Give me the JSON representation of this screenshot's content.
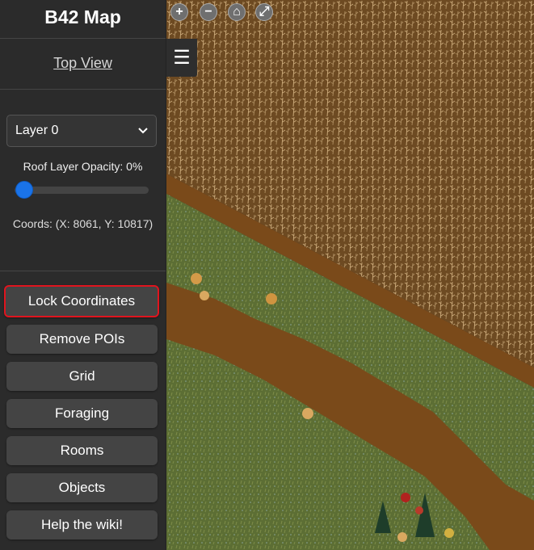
{
  "sidebar": {
    "title": "B42 Map",
    "top_view_link": "Top View",
    "layer_select": {
      "selected": "Layer 0"
    },
    "roof_opacity_label": "Roof Layer Opacity: 0%",
    "roof_opacity_level": 0,
    "coords_label": "Coords: (X: 8061, Y: 10817)",
    "buttons": [
      {
        "label": "Lock Coordinates"
      },
      {
        "label": "Remove POIs"
      },
      {
        "label": "Grid"
      },
      {
        "label": "Foraging"
      },
      {
        "label": "Rooms"
      },
      {
        "label": "Objects"
      },
      {
        "label": "Help the wiki!"
      }
    ]
  },
  "map": {
    "controls": [
      {
        "icon": "plus-icon",
        "glyph": "+"
      },
      {
        "icon": "minus-icon",
        "glyph": "−"
      },
      {
        "icon": "home-icon",
        "glyph": "⌂"
      },
      {
        "icon": "fullscreen-icon",
        "glyph": "⤢"
      }
    ],
    "menu_glyph": "☰"
  },
  "colors": {
    "sidebar_bg": "#2b2b2b",
    "button_bg": "#444444",
    "highlight_border": "#e0141e",
    "slider_thumb": "#1a73e8"
  }
}
